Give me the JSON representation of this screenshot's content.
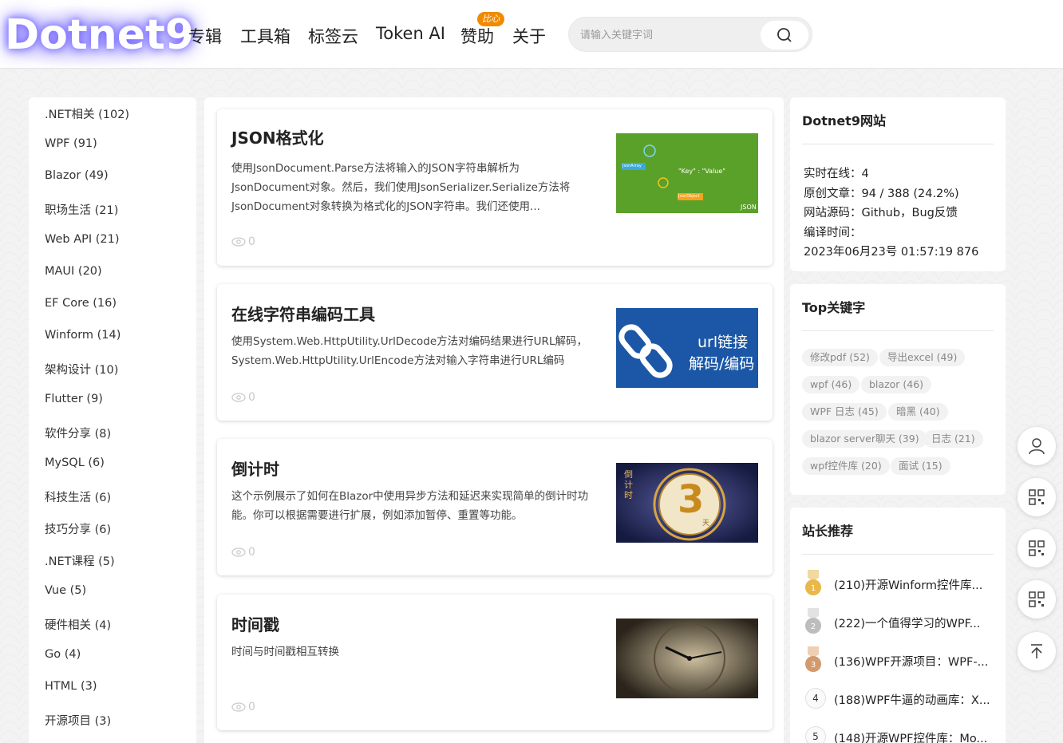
{
  "header": {
    "logo": "Dotnet9",
    "nav": [
      {
        "label": "专辑"
      },
      {
        "label": "工具箱"
      },
      {
        "label": "标签云"
      },
      {
        "label": "Token AI"
      },
      {
        "label": "赞助"
      },
      {
        "label": "关于"
      }
    ],
    "badge": "比心",
    "search_placeholder": "请输入关键字词"
  },
  "categories": [
    ".NET相关 (102)",
    "WPF (91)",
    "Blazor (49)",
    "职场生活 (21)",
    "Web API (21)",
    "MAUI (20)",
    "EF Core (16)",
    "Winform (14)",
    "架构设计 (10)",
    "Flutter (9)",
    "软件分享 (8)",
    "MySQL (6)",
    "科技生活 (6)",
    "技巧分享 (6)",
    ".NET课程 (5)",
    "Vue (5)",
    "硬件相关 (4)",
    "Go (4)",
    "HTML (3)",
    "开源项目 (3)"
  ],
  "articles": [
    {
      "title": "JSON格式化",
      "desc": "使用JsonDocument.Parse方法将输入的JSON字符串解析为JsonDocument对象。然后，我们使用JsonSerializer.Serialize方法将JsonDocument对象转换为格式化的JSON字符串。我们还使用...",
      "views": "0",
      "thumb": {
        "line1": "\"Key\" : \"Value\"",
        "label_a": "JsonArray",
        "label_b": "JsonObject",
        "corner": "JSON",
        "bg": "#5aa12a"
      }
    },
    {
      "title": "在线字符串编码工具",
      "desc": "使用System.Web.HttpUtility.UrlDecode方法对编码结果进行URL解码，System.Web.HttpUtility.UrlEncode方法对输入字符串进行URL编码",
      "views": "0",
      "thumb": {
        "line1": "url链接",
        "line2": "解码/编码",
        "bg": "#1b57a6"
      }
    },
    {
      "title": "倒计时",
      "desc": "这个示例展示了如何在Blazor中使用异步方法和延迟来实现简单的倒计时功能。你可以根据需要进行扩展，例如添加暂停、重置等功能。",
      "views": "0",
      "thumb": {
        "vertical": "倒计时",
        "number": "3",
        "unit": "天",
        "bg": "#1e2556"
      }
    },
    {
      "title": "时间戳",
      "desc": "时间与时间戳相互转换",
      "views": "0",
      "thumb": {
        "bg": "#3a3226"
      }
    }
  ],
  "site": {
    "title": "Dotnet9网站",
    "online": "实时在线：4",
    "original": "原创文章：94 / 388 (24.2%)",
    "source": "网站源码：Github，Bug反馈",
    "compile_label": "编译时间：",
    "compile_time": "2023年06月23号 01:57:19 876"
  },
  "keywords": {
    "title": "Top关键字",
    "tags": [
      "修改pdf (52)",
      "导出excel (49)",
      "wpf (46)",
      "blazor (46)",
      "WPF 日志 (45)",
      "暗黑 (40)",
      "blazor server聊天 (39)",
      "日志 (21)",
      "wpf控件库 (20)",
      "面试 (15)"
    ]
  },
  "recommend": {
    "title": "站长推荐",
    "items": [
      {
        "rank": "1",
        "text": "(210)开源Winform控件库..."
      },
      {
        "rank": "2",
        "text": "(222)一个值得学习的WPF..."
      },
      {
        "rank": "3",
        "text": "(136)WPF开源项目：WPF-..."
      },
      {
        "rank": "4",
        "text": "(188)WPF牛逼的动画库：X..."
      },
      {
        "rank": "5",
        "text": "(148)开源WPF控件库：Mo..."
      }
    ]
  },
  "colors": {
    "gold": "#e9b84a",
    "silver": "#bdbdbd",
    "bronze": "#d39a6c",
    "badge": "#f08a00"
  }
}
